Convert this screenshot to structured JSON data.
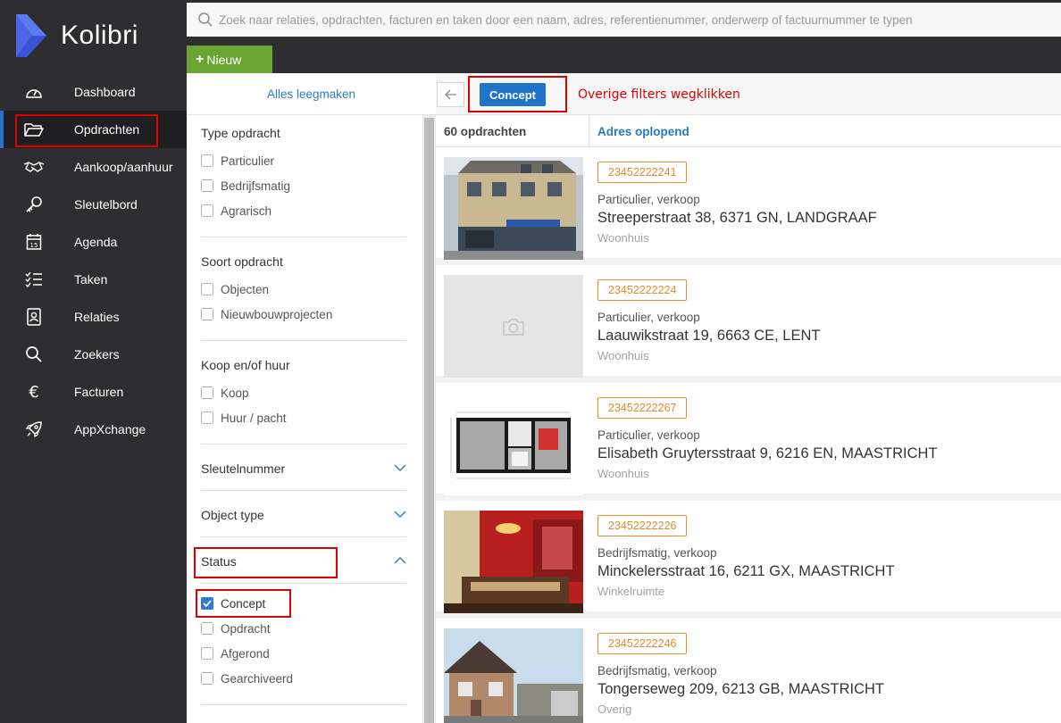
{
  "app": {
    "name": "Kolibri"
  },
  "nav": [
    {
      "label": "Dashboard",
      "icon": "dashboard-icon"
    },
    {
      "label": "Opdrachten",
      "icon": "folder-icon",
      "active": true
    },
    {
      "label": "Aankoop/aanhuur",
      "icon": "handshake-icon"
    },
    {
      "label": "Sleutelbord",
      "icon": "key-icon"
    },
    {
      "label": "Agenda",
      "icon": "calendar-icon"
    },
    {
      "label": "Taken",
      "icon": "tasks-icon"
    },
    {
      "label": "Relaties",
      "icon": "contacts-icon"
    },
    {
      "label": "Zoekers",
      "icon": "search-icon"
    },
    {
      "label": "Facturen",
      "icon": "euro-icon"
    },
    {
      "label": "AppXchange",
      "icon": "rocket-icon"
    }
  ],
  "search": {
    "placeholder": "Zoek naar relaties, opdrachten, facturen en taken door een naam, adres, referentienummer, onderwerp of factuurnummer te typen"
  },
  "toolbar": {
    "new_label": "Nieuw"
  },
  "filters": {
    "clear_label": "Alles leegmaken",
    "type": {
      "title": "Type opdracht",
      "options": [
        "Particulier",
        "Bedrijfsmatig",
        "Agrarisch"
      ]
    },
    "soort": {
      "title": "Soort opdracht",
      "options": [
        "Objecten",
        "Nieuwbouwprojecten"
      ]
    },
    "koop": {
      "title": "Koop en/of huur",
      "options": [
        "Koop",
        "Huur / pacht"
      ]
    },
    "sleutel": {
      "title": "Sleutelnummer"
    },
    "object": {
      "title": "Object type"
    },
    "status": {
      "title": "Status",
      "options": [
        {
          "label": "Concept",
          "checked": true
        },
        {
          "label": "Opdracht",
          "checked": false
        },
        {
          "label": "Afgerond",
          "checked": false
        },
        {
          "label": "Gearchiveerd",
          "checked": false
        }
      ]
    }
  },
  "active_filter": {
    "chip": "Concept",
    "annotation": "Overige filters wegklikken"
  },
  "results": {
    "count": "60 opdrachten",
    "sort": "Adres oplopend",
    "items": [
      {
        "ref": "23452222241",
        "meta": "Particulier, verkoop",
        "address": "Streeperstraat 38, 6371 GN, LANDGRAAF",
        "kind": "Woonhuis"
      },
      {
        "ref": "23452222224",
        "meta": "Particulier, verkoop",
        "address": "Laauwikstraat 19, 6663 CE, LENT",
        "kind": "Woonhuis"
      },
      {
        "ref": "23452222267",
        "meta": "Particulier, verkoop",
        "address": "Elisabeth Gruytersstraat 9, 6216 EN, MAASTRICHT",
        "kind": "Woonhuis"
      },
      {
        "ref": "23452222226",
        "meta": "Bedrijfsmatig, verkoop",
        "address": "Minckelersstraat 16, 6211 GX, MAASTRICHT",
        "kind": "Winkelruimte"
      },
      {
        "ref": "23452222246",
        "meta": "Bedrijfsmatig, verkoop",
        "address": "Tongerseweg 209, 6213 GB, MAASTRICHT",
        "kind": "Overig"
      }
    ]
  },
  "colors": {
    "sidebar": "#2e2e30",
    "accent": "#1f74c9",
    "new_button": "#6aa534",
    "ref_badge": "#e38a2d",
    "highlight": "#e00000"
  }
}
